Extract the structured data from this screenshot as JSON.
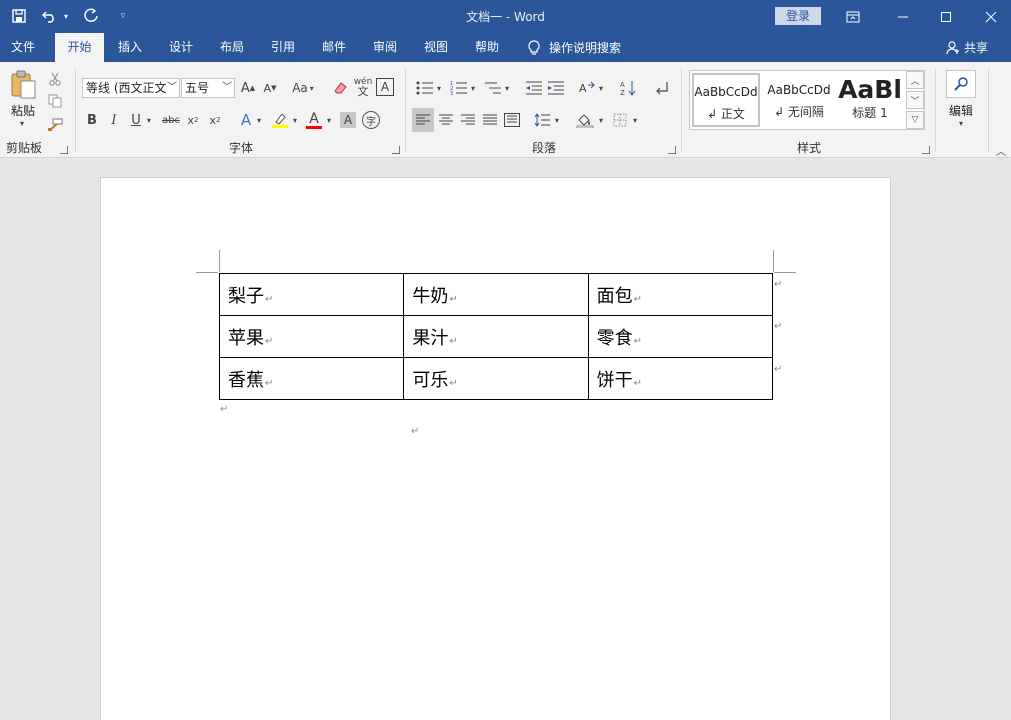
{
  "window": {
    "title": "文档一  -  Word",
    "login_label": "登录"
  },
  "tabs": [
    {
      "label": "文件"
    },
    {
      "label": "开始"
    },
    {
      "label": "插入"
    },
    {
      "label": "设计"
    },
    {
      "label": "布局"
    },
    {
      "label": "引用"
    },
    {
      "label": "邮件"
    },
    {
      "label": "审阅"
    },
    {
      "label": "视图"
    },
    {
      "label": "帮助"
    }
  ],
  "tell_me": "操作说明搜索",
  "share_label": "共享",
  "clipboard": {
    "paste_label": "粘贴",
    "group_label": "剪贴板"
  },
  "font": {
    "name": "等线 (西文正文",
    "size": "五号",
    "case_label": "Aa",
    "phonetic_label": "wén",
    "group_label": "字体"
  },
  "paragraph": {
    "group_label": "段落"
  },
  "styles": {
    "items": [
      {
        "sample": "AaBbCcDd",
        "name": "↲ 正文"
      },
      {
        "sample": "AaBbCcDd",
        "name": "↲ 无间隔"
      },
      {
        "sample": "AaBl",
        "name": "标题 1"
      }
    ],
    "group_label": "样式"
  },
  "editing": {
    "label": "编辑"
  },
  "document": {
    "table": [
      [
        "梨子",
        "牛奶",
        "面包"
      ],
      [
        "苹果",
        "果汁",
        "零食"
      ],
      [
        "香蕉",
        "可乐",
        "饼干"
      ]
    ]
  },
  "colors": {
    "accent": "#2b579a",
    "highlight": "#ffff00",
    "font_color": "#ff0000"
  }
}
